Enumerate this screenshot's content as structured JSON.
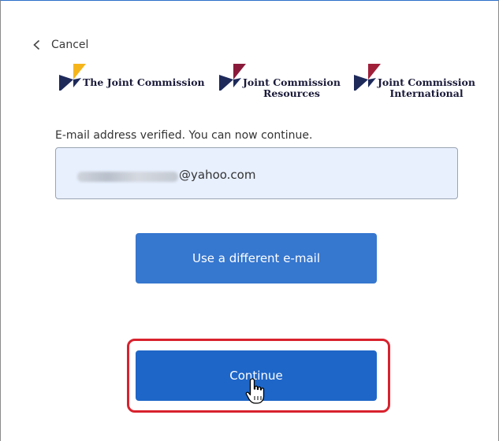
{
  "nav": {
    "cancel_label": "Cancel",
    "cancel_icon": "chevron-left-icon"
  },
  "logos": [
    {
      "name": "The Joint Commission",
      "line1": "The Joint Commission",
      "line2": "",
      "colors": [
        "#f5b51a",
        "#1e2a5a"
      ]
    },
    {
      "name": "Joint Commission Resources",
      "line1": "Joint Commission",
      "line2": "Resources",
      "colors": [
        "#8a1a3a",
        "#1e2a5a"
      ]
    },
    {
      "name": "Joint Commission International",
      "line1": "Joint Commission",
      "line2": "International",
      "colors": [
        "#a0203a",
        "#1e2a5a"
      ]
    }
  ],
  "status": {
    "message": "E-mail address verified. You can now continue."
  },
  "email": {
    "value_visible": "@yahoo.com",
    "local_part_redacted": true
  },
  "buttons": {
    "different_email_label": "Use a different e-mail",
    "continue_label": "Continue"
  },
  "colors": {
    "button_primary": "#2f72c9",
    "input_background": "#e8f0fe",
    "highlight_border": "#d8222e"
  }
}
